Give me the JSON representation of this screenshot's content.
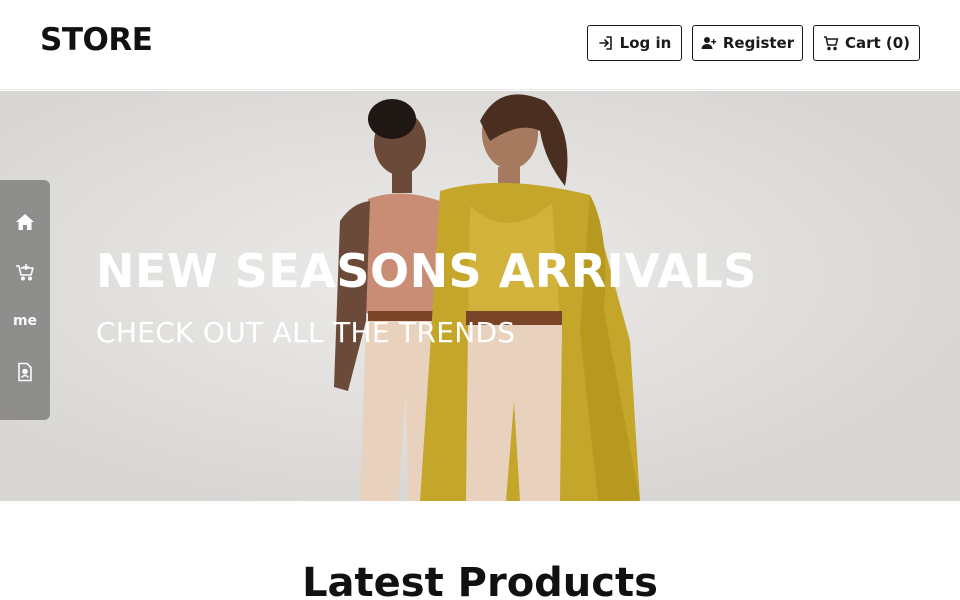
{
  "header": {
    "brand": "STORE",
    "login_label": "Log in",
    "register_label": "Register",
    "cart_label": "Cart (0)"
  },
  "hero": {
    "title": "NEW SEASONS ARRIVALS",
    "subtitle": "CHECK OUT ALL THE TRENDS"
  },
  "siderail": {
    "items": [
      {
        "icon": "home-icon"
      },
      {
        "icon": "cart-plus-icon"
      },
      {
        "icon": "me-logo",
        "label": "me"
      },
      {
        "icon": "contact-card-icon"
      }
    ]
  },
  "main": {
    "section_title": "Latest Products"
  },
  "colors": {
    "rail_bg": "#8a8a88",
    "text_dark": "#111111",
    "hero_text": "#ffffff"
  }
}
